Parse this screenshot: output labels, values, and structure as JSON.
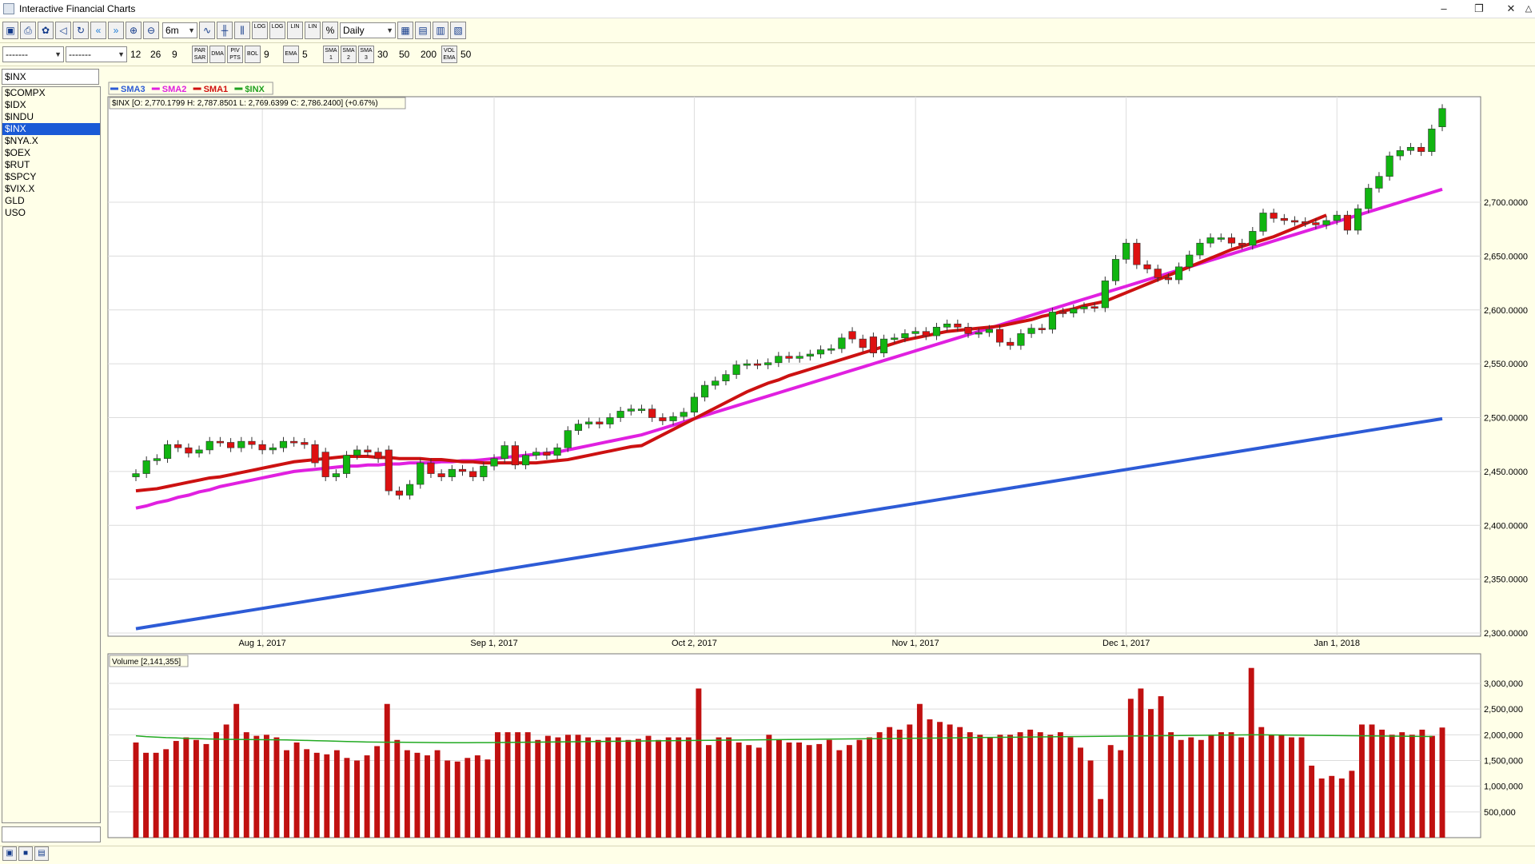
{
  "window": {
    "title": "Interactive Financial Charts",
    "controls": [
      "–",
      "❐",
      "✕",
      "△"
    ]
  },
  "toolbar": {
    "period": "6m",
    "interval": "Daily",
    "icon_buttons": [
      "save-icon",
      "print-icon",
      "settings-icon",
      "sound-icon",
      "refresh-icon",
      "scroll-left-icon",
      "scroll-right-icon",
      "zoom-in-icon",
      "zoom-out-icon"
    ],
    "log_buttons": [
      "LOG",
      "LOG",
      "LIN",
      "LIN",
      "%"
    ],
    "view_buttons": [
      "chart-view-1-icon",
      "chart-view-2-icon",
      "chart-view-3-icon",
      "chart-view-4-icon"
    ]
  },
  "indicators": {
    "select1": "-------",
    "select2": "-------",
    "macd": [
      "12",
      "26",
      "9"
    ],
    "par_sar": "PAR SAR",
    "dma": "DMA",
    "pivot": "PIV PTS",
    "bol": "BOL",
    "bol_val": "9",
    "ema": "EMA",
    "ema_val": "5",
    "sma1": "SMA 1",
    "sma2": "SMA 2",
    "sma3": "SMA 3",
    "sma_vals": [
      "30",
      "50",
      "200"
    ],
    "vol_ema": "VOL EMA",
    "vol_val": "50"
  },
  "symbols": {
    "current": "$INX",
    "list": [
      "$COMPX",
      "$IDX",
      "$INDU",
      "$INX",
      "$NYA.X",
      "$OEX",
      "$RUT",
      "$SPCY",
      "$VIX.X",
      "GLD",
      "USO"
    ],
    "selected_index": 3
  },
  "chart_data": {
    "type": "candlestick",
    "symbol": "$INX",
    "info_label": "$INX [O: 2,770.1799  H: 2,787.8501  L: 2,769.6399  C: 2,786.2400] (+0.67%)",
    "legend": [
      {
        "name": "SMA3",
        "color": "#2d5bd6"
      },
      {
        "name": "SMA2",
        "color": "#e020e0"
      },
      {
        "name": "SMA1",
        "color": "#d01010"
      },
      {
        "name": "$INX",
        "color": "#20a020"
      }
    ],
    "ylim": [
      2300000,
      2800000
    ],
    "y_ticks": [
      {
        "value": 2300000,
        "label": "2,300.0000"
      },
      {
        "value": 2350000,
        "label": "2,350.0000"
      },
      {
        "value": 2400000,
        "label": "2,400.0000"
      },
      {
        "value": 2450000,
        "label": "2,450.0000"
      },
      {
        "value": 2500000,
        "label": "2,500.0000"
      },
      {
        "value": 2550000,
        "label": "2,550.0000"
      },
      {
        "value": 2600000,
        "label": "2,600.0000"
      },
      {
        "value": 2650000,
        "label": "2,650.0000"
      },
      {
        "value": 2700000,
        "label": "2,700.0000"
      }
    ],
    "x_ticks": [
      {
        "index": 12,
        "label": "Aug 1, 2017"
      },
      {
        "index": 34,
        "label": "Sep 1, 2017"
      },
      {
        "index": 53,
        "label": "Oct 2, 2017"
      },
      {
        "index": 74,
        "label": "Nov 1, 2017"
      },
      {
        "index": 94,
        "label": "Dec 1, 2017"
      },
      {
        "index": 114,
        "label": "Jan 1, 2018"
      }
    ],
    "closes": [
      2448,
      2460,
      2462,
      2475,
      2472,
      2467,
      2470,
      2478,
      2477,
      2472,
      2478,
      2475,
      2470,
      2472,
      2478,
      2477,
      2475,
      2458,
      2445,
      2448,
      2465,
      2470,
      2468,
      2462,
      2432,
      2428,
      2438,
      2458,
      2448,
      2445,
      2452,
      2450,
      2445,
      2455,
      2462,
      2474,
      2456,
      2465,
      2468,
      2465,
      2472,
      2488,
      2494,
      2496,
      2494,
      2500,
      2506,
      2508,
      2508,
      2500,
      2497,
      2501,
      2505,
      2519,
      2530,
      2534,
      2540,
      2549,
      2550,
      2549,
      2551,
      2557,
      2555,
      2557,
      2559,
      2563,
      2564,
      2574,
      2573,
      2565,
      2560,
      2573,
      2574,
      2578,
      2580,
      2576,
      2584,
      2587,
      2584,
      2578,
      2579,
      2582,
      2570,
      2567,
      2578,
      2583,
      2582,
      2598,
      2597,
      2601,
      2603,
      2602,
      2627,
      2647,
      2662,
      2642,
      2638,
      2630,
      2628,
      2640,
      2651,
      2662,
      2667,
      2667,
      2662,
      2660,
      2673,
      2690,
      2685,
      2683,
      2682,
      2681,
      2679,
      2683,
      2688,
      2674,
      2694,
      2713,
      2724,
      2743,
      2748,
      2751,
      2747,
      2768,
      2787
    ],
    "opens": [
      2445,
      2448,
      2460,
      2462,
      2475,
      2472,
      2467,
      2470,
      2478,
      2477,
      2472,
      2478,
      2475,
      2470,
      2472,
      2478,
      2477,
      2475,
      2468,
      2445,
      2448,
      2465,
      2470,
      2468,
      2470,
      2432,
      2428,
      2438,
      2458,
      2448,
      2445,
      2452,
      2450,
      2445,
      2455,
      2462,
      2474,
      2456,
      2465,
      2468,
      2465,
      2472,
      2488,
      2494,
      2496,
      2494,
      2500,
      2506,
      2508,
      2508,
      2500,
      2497,
      2501,
      2505,
      2519,
      2530,
      2534,
      2540,
      2549,
      2550,
      2549,
      2551,
      2557,
      2555,
      2557,
      2559,
      2563,
      2564,
      2580,
      2573,
      2575,
      2560,
      2573,
      2574,
      2578,
      2580,
      2576,
      2584,
      2587,
      2584,
      2578,
      2579,
      2582,
      2570,
      2567,
      2578,
      2583,
      2582,
      2598,
      2597,
      2601,
      2603,
      2602,
      2627,
      2647,
      2662,
      2642,
      2638,
      2630,
      2628,
      2640,
      2651,
      2662,
      2667,
      2667,
      2662,
      2660,
      2673,
      2690,
      2685,
      2683,
      2682,
      2681,
      2679,
      2683,
      2688,
      2674,
      2694,
      2713,
      2724,
      2743,
      2748,
      2751,
      2747,
      2770
    ],
    "sma1": [
      2432,
      2433,
      2434,
      2436,
      2438,
      2440,
      2442,
      2444,
      2445,
      2447,
      2449,
      2451,
      2453,
      2455,
      2457,
      2459,
      2460,
      2461,
      2462,
      2463,
      2464,
      2464,
      2464,
      2463,
      2463,
      2462,
      2462,
      2462,
      2461,
      2461,
      2460,
      2459,
      2459,
      2458,
      2458,
      2458,
      2458,
      2458,
      2458,
      2459,
      2460,
      2461,
      2463,
      2465,
      2467,
      2469,
      2471,
      2473,
      2474,
      2479,
      2484,
      2489,
      2494,
      2499,
      2504,
      2509,
      2514,
      2519,
      2524,
      2528,
      2532,
      2535,
      2539,
      2542,
      2545,
      2548,
      2551,
      2554,
      2557,
      2560,
      2563,
      2566,
      2569,
      2572,
      2574,
      2576,
      2578,
      2580,
      2581,
      2582,
      2583,
      2584,
      2585,
      2587,
      2589,
      2591,
      2594,
      2596,
      2599,
      2601,
      2604,
      2606,
      2608,
      2612,
      2616,
      2620,
      2624,
      2628,
      2632,
      2636,
      2640,
      2644,
      2648,
      2652,
      2656,
      2659,
      2662,
      2665,
      2668,
      2672,
      2676,
      2680,
      2684,
      2688
    ],
    "sma2": [
      2416,
      2418,
      2421,
      2423,
      2426,
      2428,
      2431,
      2433,
      2436,
      2438,
      2440,
      2442,
      2444,
      2446,
      2448,
      2450,
      2451,
      2452,
      2453,
      2454,
      2455,
      2455,
      2456,
      2456,
      2457,
      2457,
      2458,
      2458,
      2458,
      2459,
      2459,
      2460,
      2460,
      2461,
      2462,
      2463,
      2464,
      2465,
      2466,
      2467,
      2468,
      2470,
      2472,
      2474,
      2476,
      2478,
      2480,
      2482,
      2484,
      2487,
      2490,
      2493,
      2496,
      2499,
      2502,
      2505,
      2508,
      2511,
      2514,
      2517,
      2520,
      2523,
      2526,
      2529,
      2532,
      2535,
      2538,
      2541,
      2544,
      2547,
      2550,
      2553,
      2556,
      2559,
      2562,
      2565,
      2568,
      2571,
      2574,
      2577,
      2580,
      2583,
      2586,
      2589,
      2592,
      2595,
      2598,
      2601,
      2604,
      2607,
      2610,
      2613,
      2616,
      2619,
      2622,
      2625,
      2628,
      2631,
      2634,
      2637,
      2640,
      2643,
      2646,
      2649,
      2652,
      2655,
      2658,
      2661,
      2664,
      2667,
      2670,
      2673,
      2676,
      2679,
      2682,
      2685,
      2688,
      2691,
      2694,
      2697,
      2700,
      2703,
      2706,
      2709,
      2712
    ],
    "sma3_start": 2304,
    "sma3_end": 2499,
    "volume": {
      "label": "Volume [2,141,355]",
      "ylim": [
        0,
        3500000
      ],
      "y_ticks": [
        {
          "value": 500000,
          "label": "500,000"
        },
        {
          "value": 1000000,
          "label": "1,000,000"
        },
        {
          "value": 1500000,
          "label": "1,500,000"
        },
        {
          "value": 2000000,
          "label": "2,000,000"
        },
        {
          "value": 2500000,
          "label": "2,500,000"
        },
        {
          "value": 3000000,
          "label": "3,000,000"
        }
      ],
      "values": [
        1850,
        1650,
        1650,
        1720,
        1880,
        1950,
        1900,
        1820,
        2050,
        2200,
        2600,
        2050,
        1980,
        2000,
        1950,
        1700,
        1850,
        1720,
        1650,
        1620,
        1700,
        1550,
        1500,
        1600,
        1780,
        2600,
        1900,
        1700,
        1650,
        1600,
        1700,
        1500,
        1480,
        1550,
        1600,
        1520,
        2050,
        2050,
        2050,
        2050,
        1900,
        1980,
        1950,
        2000,
        2000,
        1950,
        1900,
        1950,
        1950,
        1900,
        1920,
        1980,
        1900,
        1950,
        1950,
        1950,
        2900,
        1800,
        1950,
        1950,
        1850,
        1800,
        1750,
        2000,
        1900,
        1850,
        1850,
        1800,
        1820,
        1900,
        1700,
        1800,
        1900,
        1950,
        2050,
        2150,
        2100,
        2200,
        2600,
        2300,
        2250,
        2200,
        2150,
        2050,
        2000,
        1950,
        2000,
        2000,
        2050,
        2100,
        2050,
        2000,
        2050,
        1950,
        1750,
        1500,
        750,
        1800,
        1700,
        2700,
        2900,
        2500,
        2750,
        2050,
        1900,
        1950,
        1900,
        2000,
        2050,
        2050,
        1950,
        3300,
        2150,
        2000,
        2000,
        1950,
        1950,
        1400,
        1150,
        1200,
        1150,
        1300,
        2200,
        2200,
        2100,
        2000,
        2050,
        2000,
        2100,
        1980,
        2141
      ],
      "ema": [
        1980,
        1965,
        1955,
        1945,
        1940,
        1930,
        1925,
        1920,
        1915,
        1912,
        1910,
        1908,
        1906,
        1905,
        1903,
        1900,
        1895,
        1890,
        1885,
        1880,
        1875,
        1870,
        1865,
        1860,
        1858,
        1856,
        1855,
        1854,
        1852,
        1850,
        1848,
        1846,
        1845,
        1846,
        1847,
        1848,
        1850,
        1852,
        1854,
        1856,
        1858,
        1860,
        1862,
        1864,
        1866,
        1868,
        1870,
        1872,
        1874,
        1876,
        1878,
        1880,
        1882,
        1884,
        1886,
        1888,
        1890,
        1892,
        1894,
        1896,
        1898,
        1900,
        1902,
        1904,
        1906,
        1908,
        1910,
        1912,
        1914,
        1916,
        1918,
        1920,
        1922,
        1924,
        1926,
        1928,
        1930,
        1932,
        1934,
        1936,
        1938,
        1940,
        1942,
        1944,
        1946,
        1948,
        1950,
        1952,
        1954,
        1956,
        1958,
        1960,
        1962,
        1964,
        1966,
        1968,
        1970,
        1972,
        1974,
        1976,
        1978,
        1980,
        1982,
        1984,
        1986,
        1988,
        1990,
        1992,
        1994,
        1996,
        1998,
        2000,
        2000,
        1998,
        1996,
        1994,
        1992,
        1990,
        1988,
        1986,
        1984,
        1982,
        1980,
        1978,
        1976,
        1974,
        1972,
        1970,
        1968,
        1966
      ]
    }
  }
}
